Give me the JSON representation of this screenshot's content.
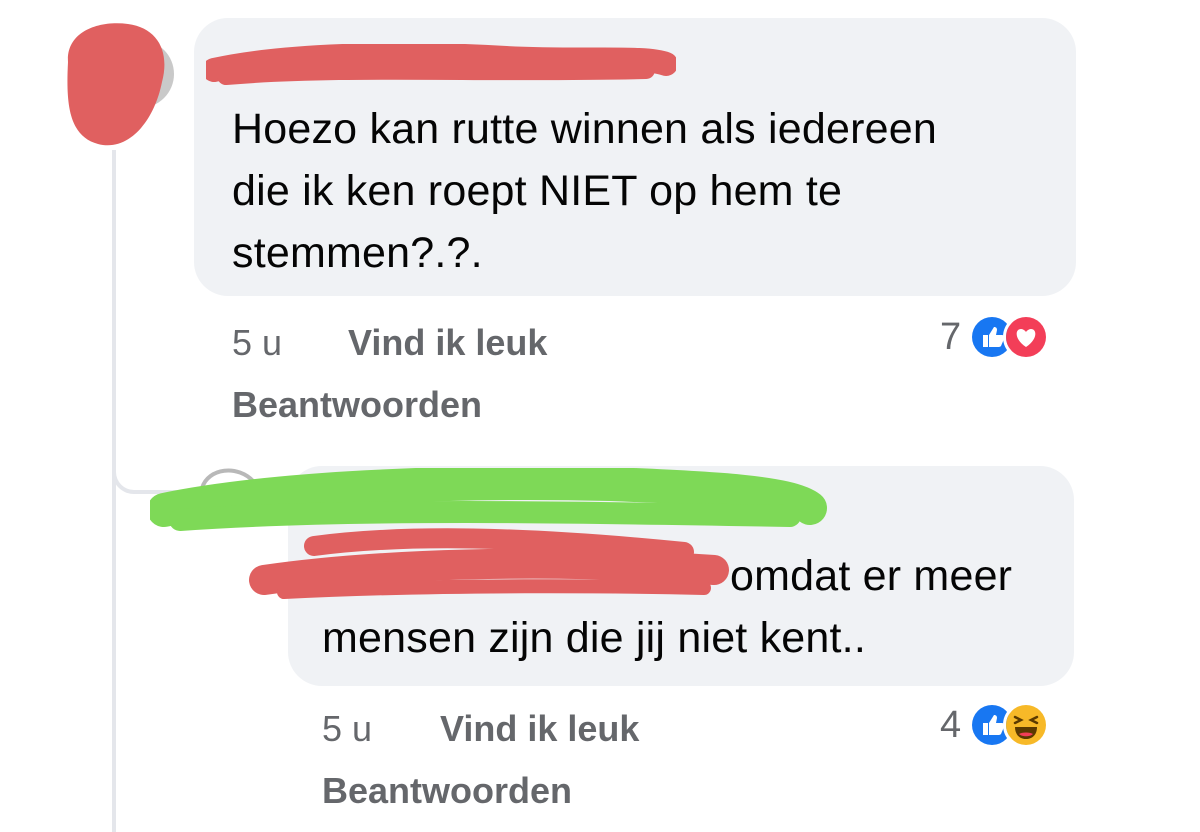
{
  "thread": {
    "comment1": {
      "text": "Hoezo kan rutte winnen als iedereen\ndie ik ken roept NIET op hem te\nstemmen?.?.",
      "line1": "Hoezo kan rutte winnen als iedereen",
      "line2": "die ik ken roept NIET op hem te",
      "line3": "stemmen?.?.",
      "time": "5 u",
      "like_label": "Vind ik leuk",
      "reply_label": "Beantwoorden",
      "reaction_count": "7",
      "reactions": [
        "like-icon",
        "love-icon"
      ]
    },
    "comment2": {
      "line1": "omdat er meer",
      "line2": "mensen zijn die jij niet kent..",
      "time": "5 u",
      "like_label": "Vind ik leuk",
      "reply_label": "Beantwoorden",
      "reaction_count": "4",
      "reactions": [
        "like-icon",
        "haha-icon"
      ]
    }
  },
  "colors": {
    "bubble": "#f0f2f5",
    "meta_text": "#65676b",
    "like_blue": "#1877f2",
    "love_red": "#f33e58",
    "haha_yellow": "#f7b928",
    "scribble_red": "#e06060",
    "scribble_green": "#7ed957"
  }
}
